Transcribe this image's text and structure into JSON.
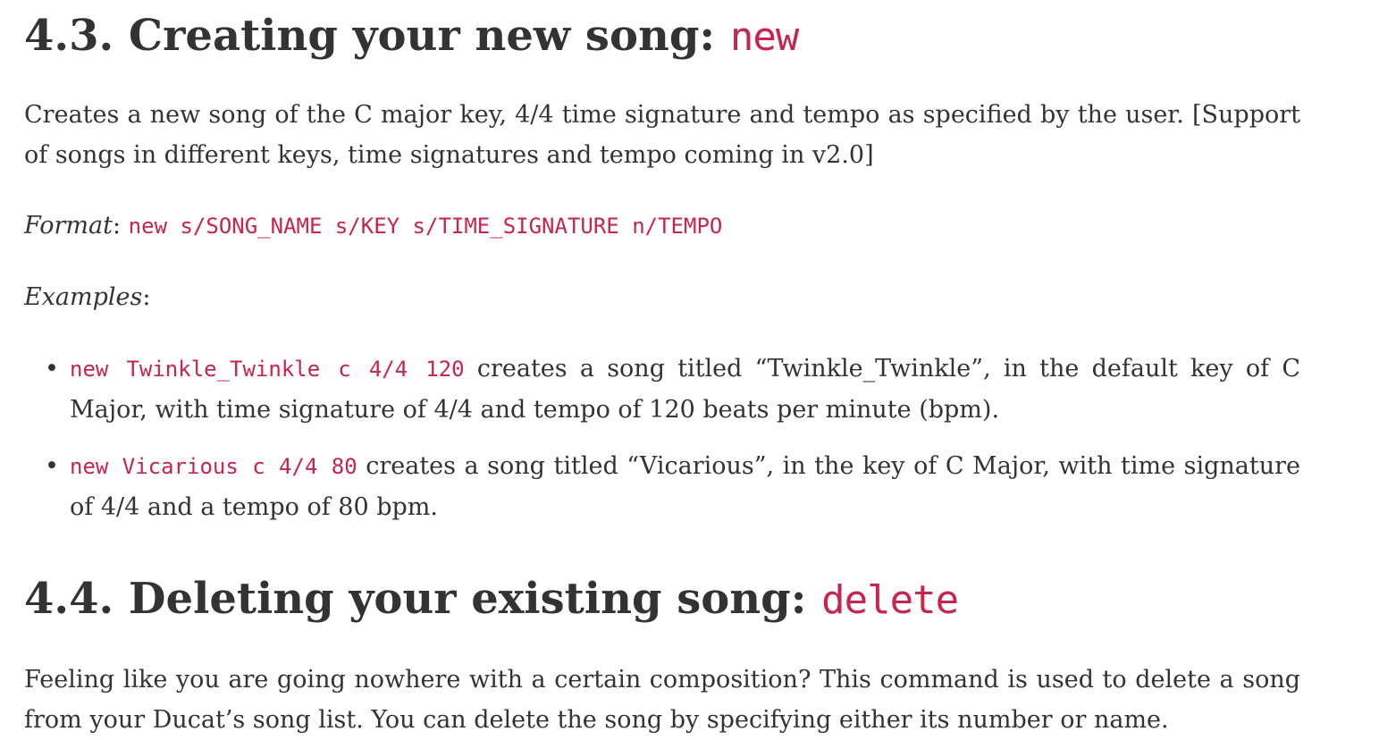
{
  "section_43": {
    "number_title": "4.3. Creating your new song: ",
    "command": "new",
    "intro": "Creates a new song of the C major key, 4/4 time signature and tempo as specified by the user. [Support of songs in different keys, time signatures and tempo coming in v2.0]",
    "format_label": "Format",
    "format_colon": ": ",
    "format_code": "new s/SONG_NAME s/KEY s/TIME_SIGNATURE n/TEMPO",
    "examples_label": "Examples",
    "examples_colon": ":",
    "bullet": "•",
    "examples": [
      {
        "code": "new Twinkle_Twinkle c 4/4 120",
        "text": " creates a song titled “Twinkle_Twinkle”, in the default key of C Major, with time signature of 4/4 and tempo of 120 beats per minute (bpm)."
      },
      {
        "code": "new Vicarious c 4/4 80",
        "text": " creates a song titled “Vicarious”, in the key of C Major, with time signature of 4/4 and a tempo of 80 bpm."
      }
    ]
  },
  "section_44": {
    "number_title": "4.4. Deleting your existing song: ",
    "command": "delete",
    "intro": "Feeling like you are going nowhere with a certain composition? This command is used to delete a song from your Ducat’s song list. You can delete the song by specifying either its number or name."
  }
}
